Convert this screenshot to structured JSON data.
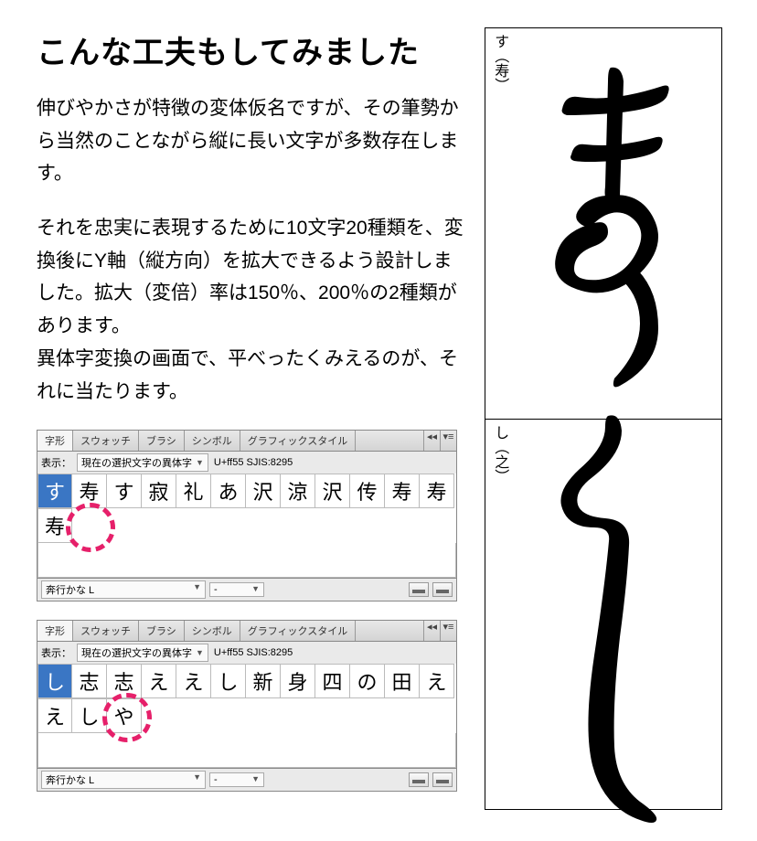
{
  "heading": "こんな工夫もしてみました",
  "paragraph1": "伸びやかさが特徴の変体仮名ですが、その筆勢から当然のことながら縦に長い文字が多数存在します。",
  "paragraph2_line1": "それを忠実に表現するために10文字20種類を、変換後にY軸（縦方向）を拡大できるよう設計しました。拡大（変倍）率は150％、200％の2種類があります。",
  "paragraph2_line2": "異体字変換の画面で、平べったくみえるのが、それに当たります。",
  "panel": {
    "tabs": [
      "字形",
      "スウォッチ",
      "ブラシ",
      "シンボル",
      "グラフィックスタイル"
    ],
    "show_label": "表示：",
    "select_text": "現在の選択文字の異体字",
    "font_name": "奔行かな L",
    "style_placeholder": "-"
  },
  "panel1": {
    "codepoint": "U+ff55  SJIS:8295",
    "row1": [
      "す",
      "寿",
      "す",
      "寂",
      "礼",
      "あ",
      "沢",
      "涼",
      "沢",
      "传",
      "寿",
      "寿"
    ],
    "row2": [
      "寿"
    ]
  },
  "panel2": {
    "codepoint": "U+ff55  SJIS:8295",
    "row1": [
      "し",
      "志",
      "志",
      "え",
      "え",
      "し",
      "新",
      "身",
      "四",
      "の",
      "田",
      "え"
    ],
    "row2": [
      "え",
      "し",
      "や"
    ]
  },
  "samples": [
    {
      "label": "す（寿）"
    },
    {
      "label": "し（之）"
    }
  ]
}
